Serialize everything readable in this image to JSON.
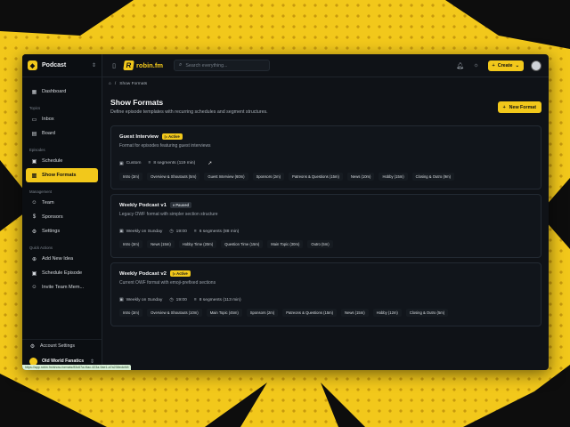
{
  "workspace": {
    "name": "Podcast"
  },
  "sidebar": {
    "dashboard": "Dashboard",
    "sections": [
      {
        "title": "Topics",
        "items": [
          {
            "label": "Inbox",
            "icon": "inbox-icon"
          },
          {
            "label": "Board",
            "icon": "board-icon"
          }
        ]
      },
      {
        "title": "Episodes",
        "items": [
          {
            "label": "Schedule",
            "icon": "calendar-icon"
          },
          {
            "label": "Show Formats",
            "icon": "formats-icon",
            "active": true
          }
        ]
      },
      {
        "title": "Management",
        "items": [
          {
            "label": "Team",
            "icon": "team-icon"
          },
          {
            "label": "Sponsors",
            "icon": "dollar-icon"
          },
          {
            "label": "Settings",
            "icon": "gear-icon"
          }
        ]
      },
      {
        "title": "Quick Actions",
        "items": [
          {
            "label": "Add New Idea",
            "icon": "plus-circle-icon"
          },
          {
            "label": "Schedule Episode",
            "icon": "calendar-plus-icon"
          },
          {
            "label": "Invite Team Mem...",
            "icon": "user-plus-icon"
          }
        ]
      }
    ],
    "account_settings": "Account Settings",
    "user_name": "Old World Fanatics"
  },
  "topbar": {
    "brand": "robin.fm",
    "search_placeholder": "Search everything...",
    "create_label": "Create"
  },
  "breadcrumb": {
    "separator": "/",
    "current": "Show Formats"
  },
  "page": {
    "title": "Show Formats",
    "subtitle": "Define episode templates with recurring schedules and segment structures.",
    "new_button": "New Format"
  },
  "formats": [
    {
      "title": "Guest Interview",
      "badge": "Active",
      "badge_type": "active",
      "description": "Format for episodes featuring guest interviews",
      "schedule": "Custom",
      "time": "",
      "segments_summary": "8 segments (119 min)",
      "segments": [
        "Intro (3m)",
        "Overview & Shoutouts (5m)",
        "Guest Interview (60m)",
        "Sponsors (2m)",
        "Patreons & Questions (15m)",
        "News (10m)",
        "Hobby (15m)",
        "Closing & Outro (9m)"
      ]
    },
    {
      "title": "Weekly Podcast v1",
      "badge": "Paused",
      "badge_type": "paused",
      "description": "Legacy OWF format with simpler section structure",
      "schedule": "Weekly on Sunday",
      "time": "19:00",
      "segments_summary": "6 segments (88 min)",
      "segments": [
        "Intro (3m)",
        "News (15m)",
        "Hobby Time (20m)",
        "Question Time (15m)",
        "Main Topic (30m)",
        "Outro (5m)"
      ]
    },
    {
      "title": "Weekly Podcast v2",
      "badge": "Active",
      "badge_type": "active",
      "description": "Current OWF format with emoji-prefixed sections",
      "schedule": "Weekly on Sunday",
      "time": "19:00",
      "segments_summary": "8 segments (113 min)",
      "segments": [
        "Intro (3m)",
        "Overview & Shoutouts (10m)",
        "Main Topic (45m)",
        "Sponsors (2m)",
        "Patreons & Questions (15m)",
        "News (15m)",
        "Hobby (12m)",
        "Closing & Outro (5m)"
      ]
    }
  ],
  "status_url": "https://app.robin.fm/show-formats/83c67a-f4ac-423a-9ae1-a7a238edcf48",
  "colors": {
    "accent": "#f2c81b",
    "background": "#0f1217"
  }
}
